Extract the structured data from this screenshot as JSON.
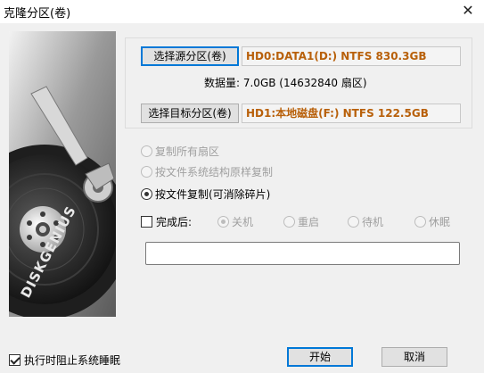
{
  "window": {
    "title": "克隆分区(卷)",
    "close_glyph": "✕"
  },
  "banner": {
    "brand": "DISKGENIUS"
  },
  "source": {
    "button_label": "选择源分区(卷)",
    "value": "HD0:DATA1(D:) NTFS 830.3GB"
  },
  "data_size": "数据量: 7.0GB (14632840 扇区)",
  "target": {
    "button_label": "选择目标分区(卷)",
    "value": "HD1:本地磁盘(F:) NTFS 122.5GB"
  },
  "copy_modes": [
    {
      "label": "复制所有扇区",
      "checked": false,
      "enabled": false
    },
    {
      "label": "按文件系统结构原样复制",
      "checked": false,
      "enabled": false
    },
    {
      "label": "按文件复制(可消除碎片)",
      "checked": true,
      "enabled": true
    }
  ],
  "after_complete": {
    "label": "完成后:",
    "checked": false,
    "options": [
      "关机",
      "重启",
      "待机",
      "休眠"
    ]
  },
  "path_input": {
    "value": ""
  },
  "prevent_sleep": {
    "label": "执行时阻止系统睡眠",
    "checked": true
  },
  "buttons": {
    "start": "开始",
    "cancel": "取消"
  },
  "colors": {
    "value_text": "#b8600a",
    "focus_border": "#0078d7"
  }
}
